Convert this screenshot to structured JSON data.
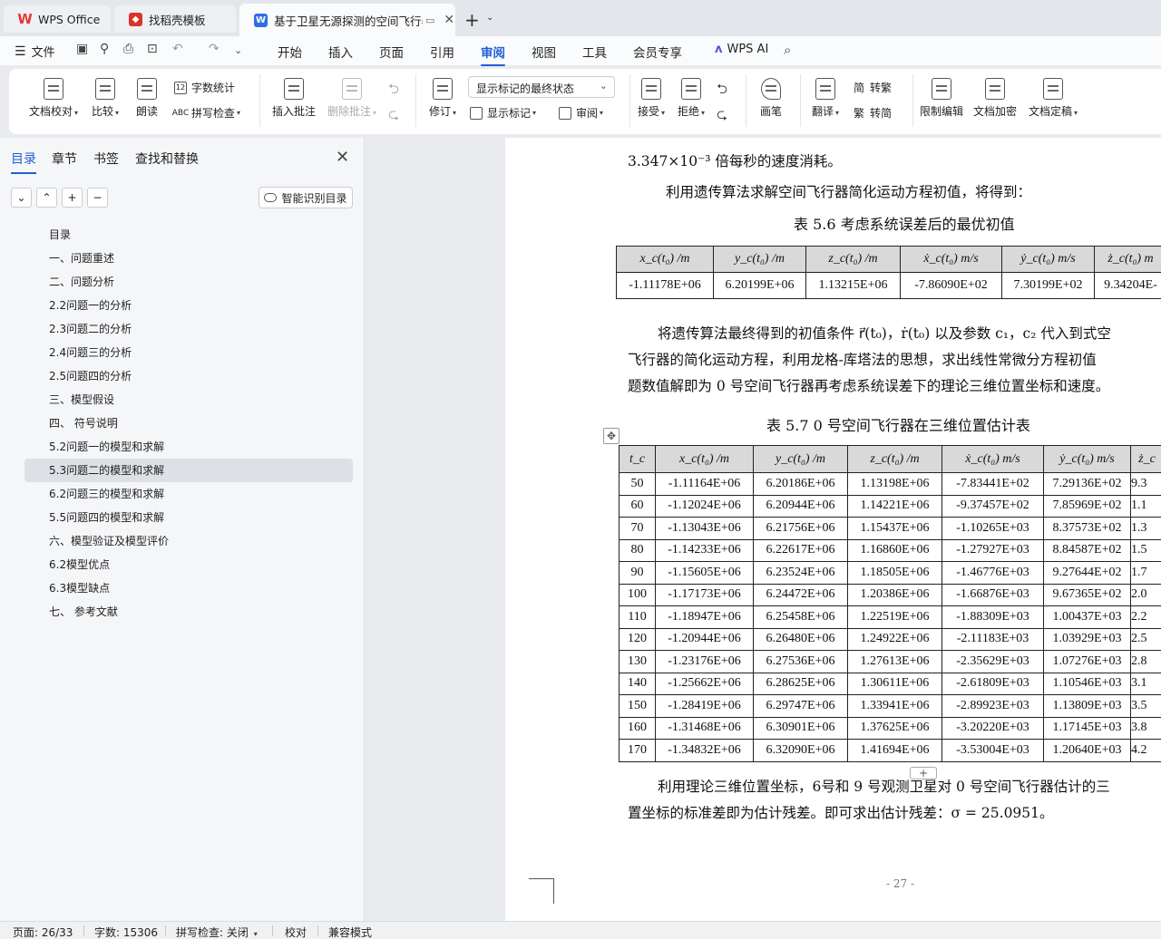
{
  "tabs": {
    "wps_label": "WPS Office",
    "daoke_label": "找稻壳模板",
    "doc_title": "基于卫星无源探测的空间飞行器",
    "add_symbol": "+"
  },
  "menu": {
    "file": "文件",
    "items": [
      "开始",
      "插入",
      "页面",
      "引用",
      "审阅",
      "视图",
      "工具",
      "会员专享"
    ],
    "active_index": 4,
    "ai_label": "WPS AI"
  },
  "ribbon": {
    "doc_check": "文档校对",
    "compare": "比较",
    "read_aloud": "朗读",
    "word_count": "字数统计",
    "spell_check": "拼写检查",
    "insert_comment": "插入批注",
    "delete_comment": "删除批注",
    "revise": "修订",
    "markup_state": "显示标记的最终状态",
    "show_markup": "显示标记",
    "review": "审阅",
    "accept": "接受",
    "reject": "拒绝",
    "pen": "画笔",
    "translate": "翻译",
    "to_traditional": "转繁",
    "to_simplified": "转简",
    "restrict_edit": "限制编辑",
    "encrypt": "文档加密",
    "finalize": "文档定稿"
  },
  "nav": {
    "tabs": [
      "目录",
      "章节",
      "书签",
      "查找和替换"
    ],
    "smart_toc": "智能识别目录",
    "toc": [
      "目录",
      "一、问题重述",
      "二、问题分析",
      "2.2问题一的分析",
      "2.3问题二的分析",
      "2.4问题三的分析",
      "2.5问题四的分析",
      "三、模型假设",
      "四、 符号说明",
      "5.2问题一的模型和求解",
      "5.3问题二的模型和求解",
      "6.2问题三的模型和求解",
      "5.5问题四的模型和求解",
      "六、模型验证及模型评价",
      "6.2模型优点",
      "6.3模型缺点",
      "七、 参考文献"
    ],
    "selected_index": 10
  },
  "doc": {
    "line1": "3.347×10⁻³ 倍每秒的速度消耗。",
    "line2": "利用遗传算法求解空间飞行器简化运动方程初值，将得到：",
    "table1_caption": "表 5.6  考虑系统误差后的最优初值",
    "table1": {
      "headers": [
        "x_c(t₀) /m",
        "y_c(t₀) /m",
        "z_c(t₀) /m",
        "ẋ_c(t₀) m/s",
        "ẏ_c(t₀) m/s",
        "ż_c(t₀) m"
      ],
      "row": [
        "-1.11178E+06",
        "6.20199E+06",
        "1.13215E+06",
        "-7.86090E+02",
        "7.30199E+02",
        "9.34204E-"
      ]
    },
    "para1": "将遗传算法最终得到的初值条件 r⃗(t₀)，ṙ(t₀) 以及参数 c₁，c₂ 代入到式空",
    "para2": "飞行器的简化运动方程，利用龙格-库塔法的思想，求出线性常微分方程初值",
    "para3": "题数值解即为 0 号空间飞行器再考虑系统误差下的理论三维位置坐标和速度。",
    "table2_caption": "表 5.7   0 号空间飞行器在三维位置估计表",
    "table2": {
      "headers": [
        "t_c",
        "x_c(t₀) /m",
        "y_c(t₀) /m",
        "z_c(t₀) /m",
        "ẋ_c(t₀) m/s",
        "ẏ_c(t₀) m/s",
        "ż_c"
      ],
      "rows": [
        [
          "50",
          "-1.11164E+06",
          "6.20186E+06",
          "1.13198E+06",
          "-7.83441E+02",
          "7.29136E+02",
          "9.3"
        ],
        [
          "60",
          "-1.12024E+06",
          "6.20944E+06",
          "1.14221E+06",
          "-9.37457E+02",
          "7.85969E+02",
          "1.1"
        ],
        [
          "70",
          "-1.13043E+06",
          "6.21756E+06",
          "1.15437E+06",
          "-1.10265E+03",
          "8.37573E+02",
          "1.3"
        ],
        [
          "80",
          "-1.14233E+06",
          "6.22617E+06",
          "1.16860E+06",
          "-1.27927E+03",
          "8.84587E+02",
          "1.5"
        ],
        [
          "90",
          "-1.15605E+06",
          "6.23524E+06",
          "1.18505E+06",
          "-1.46776E+03",
          "9.27644E+02",
          "1.7"
        ],
        [
          "100",
          "-1.17173E+06",
          "6.24472E+06",
          "1.20386E+06",
          "-1.66876E+03",
          "9.67365E+02",
          "2.0"
        ],
        [
          "110",
          "-1.18947E+06",
          "6.25458E+06",
          "1.22519E+06",
          "-1.88309E+03",
          "1.00437E+03",
          "2.2"
        ],
        [
          "120",
          "-1.20944E+06",
          "6.26480E+06",
          "1.24922E+06",
          "-2.11183E+03",
          "1.03929E+03",
          "2.5"
        ],
        [
          "130",
          "-1.23176E+06",
          "6.27536E+06",
          "1.27613E+06",
          "-2.35629E+03",
          "1.07276E+03",
          "2.8"
        ],
        [
          "140",
          "-1.25662E+06",
          "6.28625E+06",
          "1.30611E+06",
          "-2.61809E+03",
          "1.10546E+03",
          "3.1"
        ],
        [
          "150",
          "-1.28419E+06",
          "6.29747E+06",
          "1.33941E+06",
          "-2.89923E+03",
          "1.13809E+03",
          "3.5"
        ],
        [
          "160",
          "-1.31468E+06",
          "6.30901E+06",
          "1.37625E+06",
          "-3.20220E+03",
          "1.17145E+03",
          "3.8"
        ],
        [
          "170",
          "-1.34832E+06",
          "6.32090E+06",
          "1.41694E+06",
          "-3.53004E+03",
          "1.20640E+03",
          "4.2"
        ]
      ]
    },
    "para4": "利用理论三维位置坐标，6号和 9 号观测卫星对 0 号空间飞行器估计的三",
    "para5": "置坐标的标准差即为估计残差。即可求出估计残差：σ = 25.0951。",
    "page_number": "- 27 -"
  },
  "status": {
    "page": "页面: 26/33",
    "words": "字数: 15306",
    "spell": "拼写检查: 关闭",
    "proof": "校对",
    "compat": "兼容模式"
  }
}
